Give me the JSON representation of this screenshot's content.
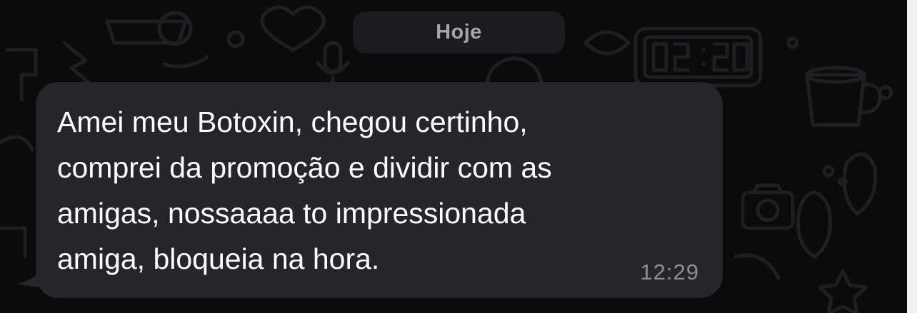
{
  "date_divider": {
    "label": "Hoje"
  },
  "message": {
    "lines": [
      "Amei meu Botoxin, chegou certinho,",
      "comprei da promoção e dividir com as",
      "amigas, nossaaaa to impressionada",
      "amiga, bloqueia na hora."
    ],
    "time": "12:29"
  },
  "colors": {
    "background": "#0b0b0b",
    "bubble": "#262628",
    "date_pill": "#1c1c1e",
    "message_text": "#ffffff",
    "timestamp": "#8d8d92",
    "doodle": "#1f1f21"
  },
  "icons": {
    "background_pattern": "chat-doodle-wallpaper",
    "doodles": [
      "clock-icon",
      "microphone-icon",
      "coffee-cup-icon",
      "camera-icon",
      "flip-flop-icon",
      "heart-icon",
      "lightning-icon",
      "star-icon"
    ]
  }
}
